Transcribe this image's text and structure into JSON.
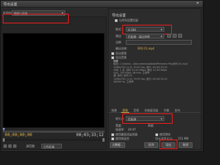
{
  "window": {
    "title": "导出设置",
    "close_glyph": "✕"
  },
  "source": {
    "label": "来源缩放:",
    "value": "缩放以适合"
  },
  "timeline": {
    "timecode_left": "00;00;00;00",
    "timecode_right": "00;03;33;12"
  },
  "bottom_left": {
    "label": "源范围:",
    "value": "工作区域"
  },
  "right_panel": {
    "section_title": "导出设置",
    "match_sequence_label": "与序列设置匹配",
    "format_label": "格式:",
    "format_value": "H.264",
    "preset_label": "预设:",
    "preset_value": "匹配源 - 高比特率",
    "comments_label": "注释:",
    "output_name_label": "输出名称:",
    "output_name_value": "序列 01.mp4",
    "export_video_label": "导出视频",
    "export_audio_label": "导出音频",
    "summary_title": "摘要",
    "summary_output_label": "输出:",
    "summary_output_text": "C:\\Users\\...\\Documents\\Adobe\\Premiere Pro\\序列 01.mp4",
    "summary_output_detail_1": "1280x720 (1.0), 29.97 fps, 逐行, 00;03;33;12",
    "summary_output_detail_2": "VBR, 1 次, 目标 10.00 Mbps, 最大 12.00 Mbps",
    "summary_output_detail_3": "AAC, 320 kbps, 48 kHz, 立体声",
    "summary_source_label": "源:",
    "summary_source_text": "序列, 序列 01",
    "summary_source_detail_1": "1280x720 (1.0), 29.97 fps, 逐行, 00;03;33;12",
    "summary_source_detail_2": "48000 Hz, 立体声"
  },
  "tabs": [
    "效果",
    "视频",
    "音频",
    "多路复用器",
    "字幕",
    "发布"
  ],
  "video_settings": {
    "width_label": "宽度:",
    "height_label": "高度:",
    "size_label": "帧大小",
    "size_value": "匹配源",
    "fps_label": "帧速率:",
    "fps_value": "29.97"
  },
  "footer": {
    "max_render_label": "使用最高渲染质量",
    "previews_label": "使用预览",
    "frame_blend_label": "使用帧混合",
    "est_size_label": "估计文件大小:",
    "est_size_value": "251 MB",
    "metadata_button": "元数据...",
    "queue_button": "队列",
    "export_button": "导出",
    "cancel_button": "取消"
  }
}
